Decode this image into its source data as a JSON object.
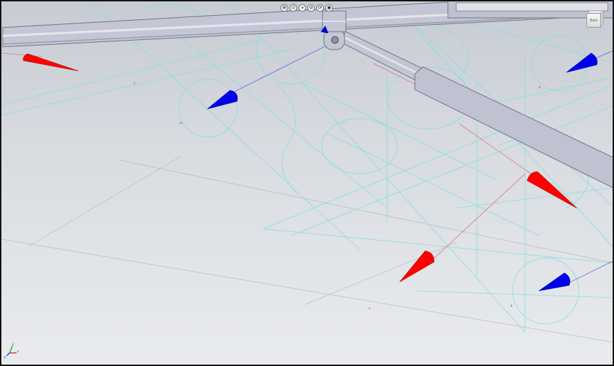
{
  "toolbar": {
    "buttons": [
      {
        "name": "zoom-fit-button",
        "glyph": "⊕"
      },
      {
        "name": "zoom-button",
        "glyph": "⊙"
      },
      {
        "name": "display-style-button",
        "glyph": "◑"
      },
      {
        "name": "section-view-button",
        "glyph": "⊘"
      },
      {
        "name": "rotate-view-button",
        "glyph": "⟳"
      },
      {
        "name": "visibility-button",
        "glyph": "◉"
      }
    ]
  },
  "viewcube": {
    "face_label": "Back"
  },
  "triad": {
    "x_label": "x",
    "y_label": "y",
    "z_label": "z"
  },
  "scene_labels": {
    "z1": "z",
    "z2": "z",
    "z3": "z",
    "x1": "x",
    "x2": "x"
  },
  "colors": {
    "force_arrow": "#ff0000",
    "moment_arrow": "#0000ee",
    "wireframe": "#7fe0e0",
    "tube_fill": "#c4c6d6",
    "tube_stroke": "#70727e"
  }
}
